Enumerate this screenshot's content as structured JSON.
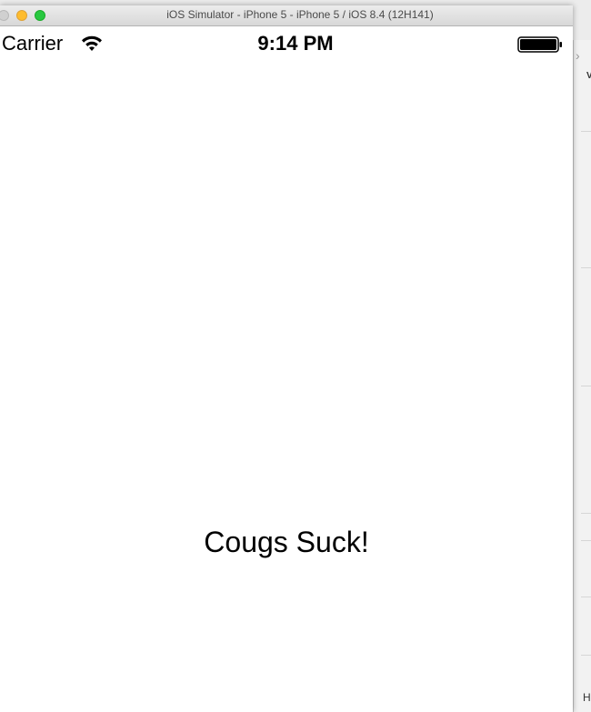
{
  "window": {
    "title": "iOS Simulator - iPhone 5 - iPhone 5 / iOS 8.4 (12H141)"
  },
  "status_bar": {
    "carrier": "Carrier",
    "time": "9:14 PM",
    "wifi_icon": "wifi-icon",
    "battery_icon": "battery-icon"
  },
  "main": {
    "label": "Cougs Suck!"
  },
  "background_app": {
    "header_letter": "V",
    "footer_letter": "H"
  }
}
